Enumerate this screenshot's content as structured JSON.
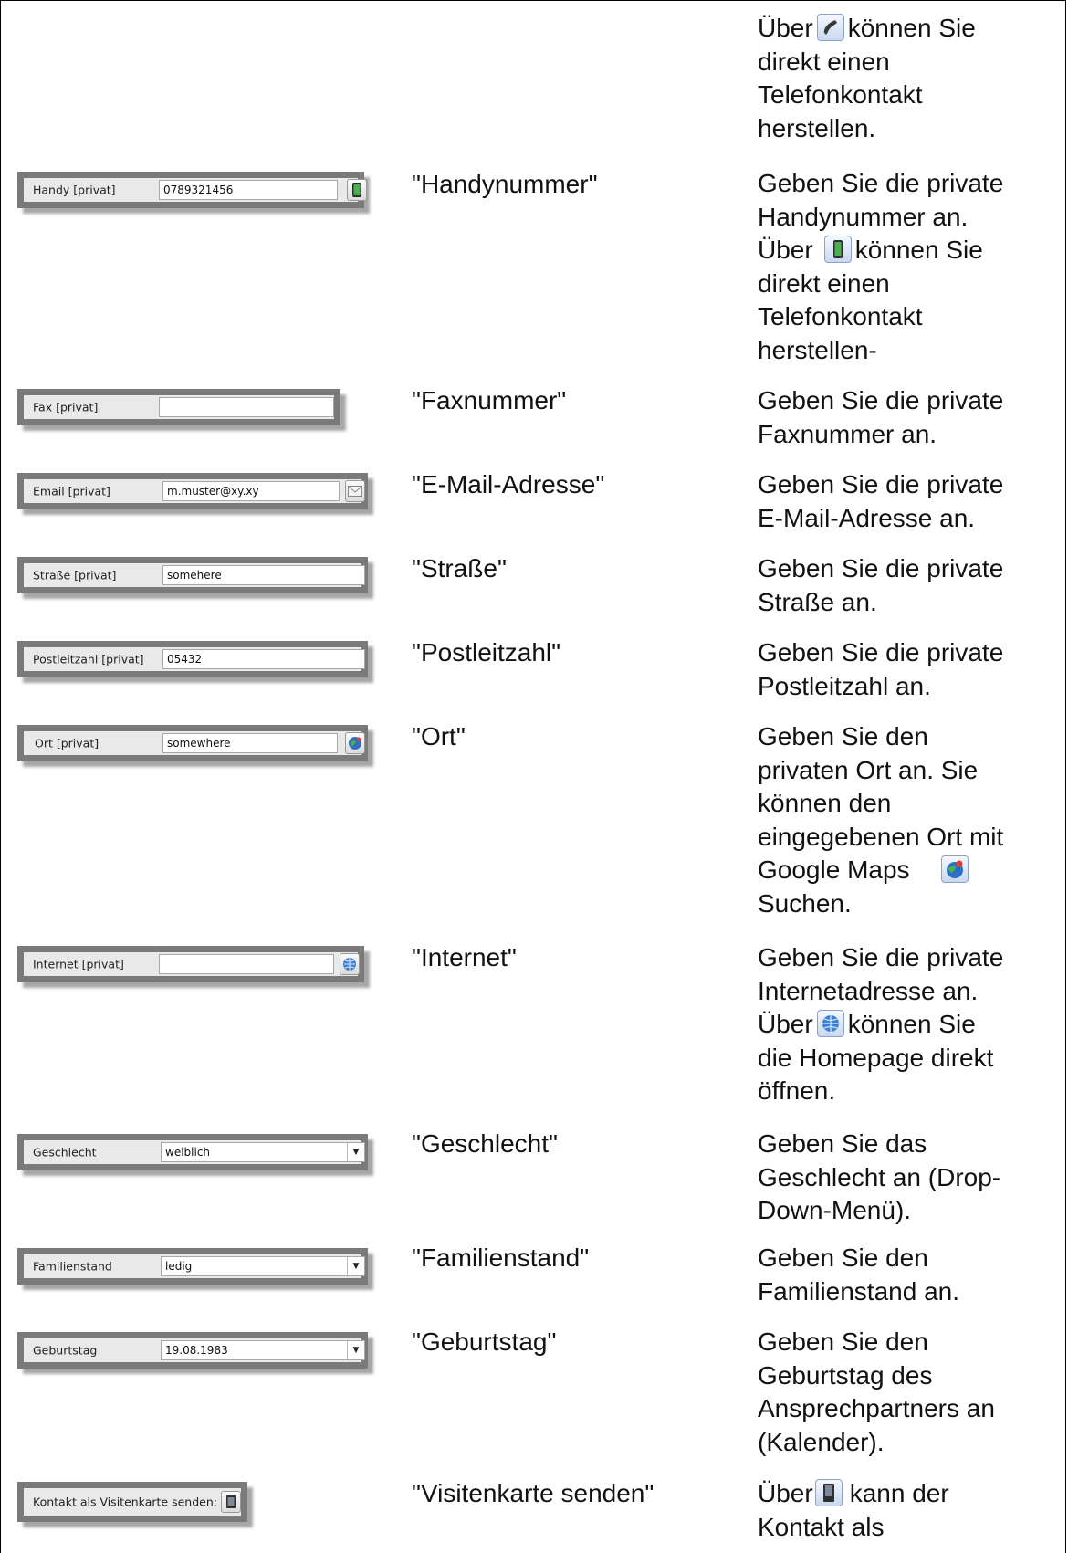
{
  "top": {
    "desc_lines": [
      "Über",
      "können Sie",
      "direkt einen",
      "Telefonkontakt",
      "herstellen."
    ],
    "icon": "phone-handset-icon"
  },
  "rows": [
    {
      "field_label": "Handy [privat]",
      "field_value": "0789321456",
      "button_icon": "mobile-phone-icon",
      "name": "\"Handynummer\"",
      "desc_lines": [
        "Geben Sie die private",
        "Handynummer an.",
        "Über",
        "können Sie",
        "direkt einen",
        "Telefonkontakt",
        "herstellen-"
      ]
    },
    {
      "field_label": "Fax [privat]",
      "field_value": "",
      "name": "\"Faxnummer\"",
      "desc_lines": [
        "Geben Sie die private",
        "Faxnummer an."
      ]
    },
    {
      "field_label": "Email [privat]",
      "field_value": "m.muster@xy.xy",
      "button_icon": "envelope-icon",
      "name": "\"E-Mail-Adresse\"",
      "desc_lines": [
        "Geben Sie die private",
        "E-Mail-Adresse an."
      ]
    },
    {
      "field_label": "Straße [privat]",
      "field_value": "somehere",
      "name": "\"Straße\"",
      "desc_lines": [
        "Geben Sie die private",
        "Straße an."
      ]
    },
    {
      "field_label": "Postleitzahl [privat]",
      "field_value": "05432",
      "name": "\"Postleitzahl\"",
      "desc_lines": [
        "Geben Sie die private",
        "Postleitzahl an."
      ]
    },
    {
      "field_label": "Ort [privat]",
      "field_value": "somewhere",
      "button_icon": "maps-globe-icon",
      "name": "\"Ort\"",
      "desc_lines": [
        "Geben Sie den",
        "privaten Ort an. Sie",
        "können den",
        "eingegebenen Ort mit",
        "Google Maps",
        "Suchen."
      ]
    },
    {
      "field_label": "Internet [privat]",
      "field_value": "",
      "button_icon": "web-globe-icon",
      "name": "\"Internet\"",
      "desc_lines": [
        "Geben Sie die private",
        "Internetadresse an.",
        "Über",
        "können Sie",
        "die Homepage direkt",
        "öffnen."
      ]
    },
    {
      "field_label": "Geschlecht",
      "field_value": "weiblich",
      "dropdown": true,
      "name": "\"Geschlecht\"",
      "desc_lines": [
        "Geben Sie das",
        "Geschlecht an (Drop-",
        "Down-Menü)."
      ]
    },
    {
      "field_label": "Familienstand",
      "field_value": "ledig",
      "dropdown": true,
      "name": "\"Familienstand\"",
      "desc_lines": [
        "Geben Sie den",
        "Familienstand an."
      ]
    },
    {
      "field_label": "Geburtstag",
      "field_value": "19.08.1983",
      "dropdown": true,
      "name": "\"Geburtstag\"",
      "desc_lines": [
        "Geben Sie den",
        "Geburtstag des",
        "Ansprechpartners an",
        "(Kalender)."
      ]
    },
    {
      "field_label": "Kontakt als Visitenkarte senden:",
      "button_icon": "business-card-icon",
      "name": "\"Visitenkarte senden\"",
      "desc_lines": [
        "Über",
        "kann der",
        "Kontakt als"
      ]
    }
  ]
}
